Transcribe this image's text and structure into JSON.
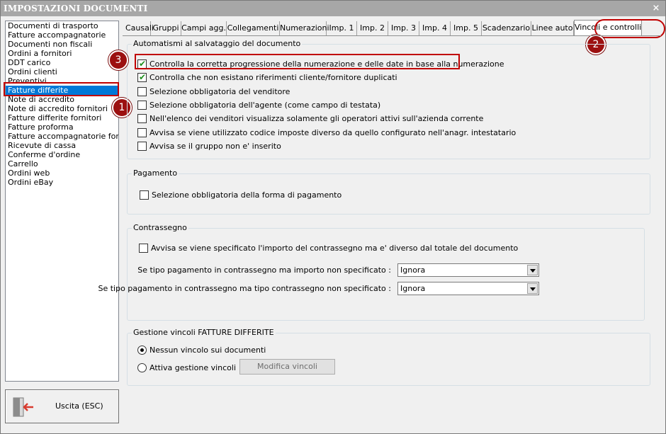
{
  "window": {
    "title": "IMPOSTAZIONI DOCUMENTI",
    "close_label": "×"
  },
  "doc_list": {
    "items": [
      "Documenti di trasporto",
      "Fatture accompagnatorie",
      "Documenti non fiscali",
      "Ordini a fornitori",
      "DDT carico",
      "Ordini clienti",
      "Preventivi",
      "Fatture differite",
      "Note di accredito",
      "Note di accredito fornitori",
      "Fatture differite fornitori",
      "Fatture proforma",
      "Fatture accompagnatorie fornito",
      "Ricevute di cassa",
      "Conferme d'ordine",
      "Carrello",
      "Ordini web",
      "Ordini eBay"
    ],
    "selected": "Fatture differite"
  },
  "exit_button": {
    "label": "Uscita (ESC)",
    "icon": "exit-door-icon"
  },
  "tabs": [
    "Causali",
    "Gruppi",
    "Campi agg.",
    "Collegamenti",
    "Numerazioni",
    "Imp. 1",
    "Imp. 2",
    "Imp. 3",
    "Imp. 4",
    "Imp. 5",
    "Scadenzario",
    "Linee auto",
    "Vincoli e controlli"
  ],
  "active_tab": "Vincoli e controlli",
  "annotations": {
    "badge1": "1",
    "badge2": "2",
    "badge3": "3",
    "color": "#9c1010"
  },
  "automatismi": {
    "title": "Automatismi al salvataggio del documento",
    "options": [
      {
        "label": "Controlla la corretta progressione della numerazione e delle date in base alla numerazione",
        "checked": true
      },
      {
        "label": "Controlla che non esistano riferimenti cliente/fornitore duplicati",
        "checked": true
      },
      {
        "label": "Selezione obbligatoria del venditore",
        "checked": false
      },
      {
        "label": "Selezione obbligatoria dell'agente (come campo di testata)",
        "checked": false
      },
      {
        "label": "Nell'elenco dei venditori visualizza solamente gli operatori attivi sull'azienda corrente",
        "checked": false
      },
      {
        "label": "Avvisa se viene utilizzato codice imposte diverso da quello configurato nell'anagr. intestatario",
        "checked": false
      },
      {
        "label": "Avvisa se il gruppo non e' inserito",
        "checked": false
      }
    ]
  },
  "pagamento": {
    "title": "Pagamento",
    "option": {
      "label": "Selezione obbligatoria della forma di pagamento",
      "checked": false
    }
  },
  "contrassegno": {
    "title": "Contrassegno",
    "option": {
      "label": "Avvisa se viene specificato l'importo del contrassegno ma e' diverso dal totale del documento",
      "checked": false
    },
    "row1_label": "Se tipo pagamento in contrassegno ma importo non specificato :",
    "row1_value": "Ignora",
    "row2_label": "Se tipo pagamento in contrassegno ma tipo contrassegno non specificato :",
    "row2_value": "Ignora"
  },
  "vincoli": {
    "title": "Gestione vincoli FATTURE DIFFERITE",
    "radio1": {
      "label": "Nessun vincolo sui documenti",
      "selected": true
    },
    "radio2": {
      "label": "Attiva gestione vincoli",
      "selected": false
    },
    "modify_button": "Modifica vincoli"
  }
}
